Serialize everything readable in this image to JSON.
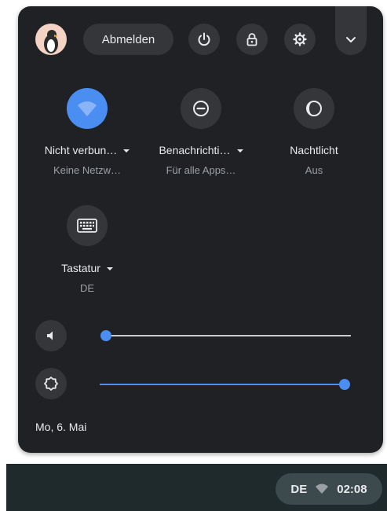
{
  "header": {
    "signout_label": "Abmelden",
    "icons": [
      "avatar",
      "power-icon",
      "lock-icon",
      "gear-icon",
      "chevron-down-icon"
    ]
  },
  "tiles": [
    {
      "label": "Nicht verbun…",
      "sub": "Keine Netzw…",
      "icon": "wifi-icon",
      "active": true
    },
    {
      "label": "Benachrichti…",
      "sub": "Für alle Apps…",
      "icon": "do-not-disturb-icon",
      "active": false
    },
    {
      "label": "Nachtlicht",
      "sub": "Aus",
      "icon": "night-light-icon",
      "active": false
    },
    {
      "label": "Tastatur",
      "sub": "DE",
      "icon": "keyboard-icon",
      "active": false
    }
  ],
  "sliders": {
    "volume": {
      "icon": "volume-icon",
      "level": 0
    },
    "brightness": {
      "icon": "brightness-icon",
      "level": 1
    }
  },
  "date": "Mo, 6. Mai",
  "shelf": {
    "ime": "DE",
    "time": "02:08"
  },
  "colors": {
    "panel_bg": "#202124",
    "button_bg": "#35363a",
    "accent": "#4a8ef1",
    "shelf_bg": "#1f2a2c"
  }
}
